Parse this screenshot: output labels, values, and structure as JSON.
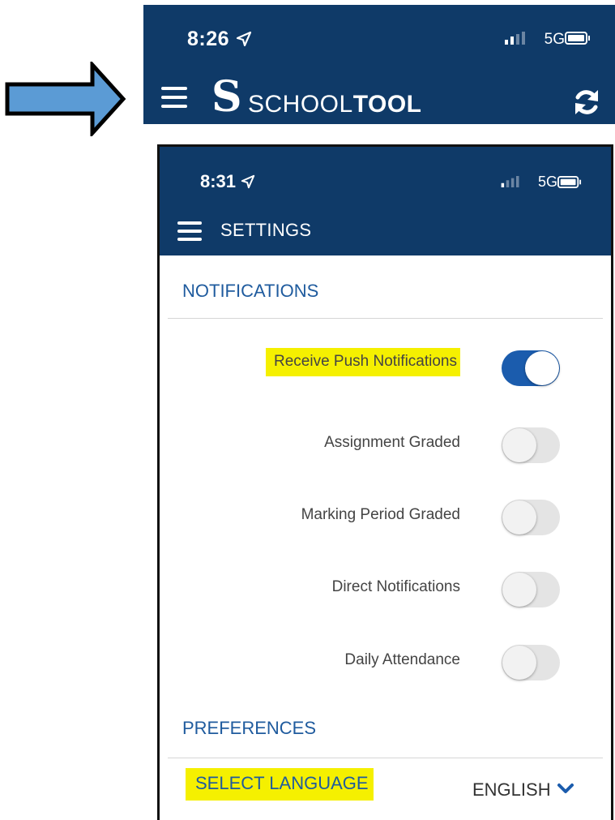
{
  "colors": {
    "header": "#0f3a68",
    "accent": "#1b5cad",
    "highlight": "#f5f000",
    "arrow": "#5b9bd5"
  },
  "top_screen": {
    "status": {
      "time": "8:26",
      "network": "5G"
    },
    "logo_letter": "S",
    "brand_regular": "SCHOOL",
    "brand_bold": "TOOL",
    "icons": [
      "hamburger-menu-icon",
      "refresh-icon",
      "location-arrow-icon",
      "signal-icon",
      "battery-icon"
    ]
  },
  "settings_screen": {
    "status": {
      "time": "8:31",
      "network": "5G"
    },
    "title": "SETTINGS",
    "notifications": {
      "heading": "NOTIFICATIONS",
      "items": [
        {
          "label": "Receive Push Notifications",
          "enabled": true
        },
        {
          "label": "Assignment Graded",
          "enabled": false
        },
        {
          "label": "Marking Period Graded",
          "enabled": false
        },
        {
          "label": "Direct Notifications",
          "enabled": false
        },
        {
          "label": "Daily Attendance",
          "enabled": false
        }
      ]
    },
    "preferences": {
      "heading": "PREFERENCES",
      "language_label": "SELECT LANGUAGE",
      "language_value": "ENGLISH"
    }
  }
}
